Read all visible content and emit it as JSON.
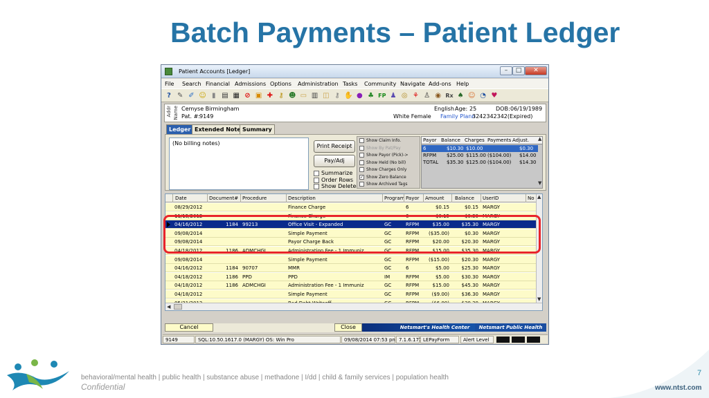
{
  "slide": {
    "title": "Batch Payments – Patient Ledger",
    "tagline": "behavioral/mental health | public health | substance abuse | methadone | I/dd | child & family services | population health",
    "confidential": "Confidential",
    "page_number": "7",
    "website": "www.ntst.com"
  },
  "window": {
    "title": "Patient Accounts [Ledger]",
    "min": "–",
    "max": "□",
    "close": "✕"
  },
  "menu": [
    "File",
    "Search",
    "Financial",
    "Admissions",
    "Options",
    "Administration",
    "Tasks",
    "Community",
    "Navigate",
    "Add-ons",
    "Help"
  ],
  "toolbar_icons": [
    {
      "name": "help-icon",
      "glyph": "?",
      "color": "#1e4fa0"
    },
    {
      "name": "wrench-icon",
      "glyph": "✎",
      "color": "#555"
    },
    {
      "name": "pencil-icon",
      "glyph": "✐",
      "color": "#2c6fc5"
    },
    {
      "name": "smiley-icon",
      "glyph": "☺",
      "color": "#c9a300"
    },
    {
      "name": "battery-icon",
      "glyph": "▮",
      "color": "#888"
    },
    {
      "name": "document-icon",
      "glyph": "▤",
      "color": "#333"
    },
    {
      "name": "calculator-icon",
      "glyph": "▦",
      "color": "#222"
    },
    {
      "name": "no-entry-icon",
      "glyph": "⊘",
      "color": "#d11"
    },
    {
      "name": "schedule-icon",
      "glyph": "▣",
      "color": "#d88a00"
    },
    {
      "name": "red-cross-icon",
      "glyph": "✚",
      "color": "#d11"
    },
    {
      "name": "key-icon",
      "glyph": "⚷",
      "color": "#b58a00"
    },
    {
      "name": "people-icon",
      "glyph": "☻",
      "color": "#2a7a2a"
    },
    {
      "name": "folder-icon",
      "glyph": "▭",
      "color": "#caa24a"
    },
    {
      "name": "printer-icon",
      "glyph": "▥",
      "color": "#444"
    },
    {
      "name": "folder-open-icon",
      "glyph": "◫",
      "color": "#caa24a"
    },
    {
      "name": "keys-icon",
      "glyph": "⚷",
      "color": "#777"
    },
    {
      "name": "hand-icon",
      "glyph": "✋",
      "color": "#b07b50"
    },
    {
      "name": "capsule-icon",
      "glyph": "●",
      "color": "#8a1fb8"
    },
    {
      "name": "leaf-icon",
      "glyph": "♣",
      "color": "#2a8a2a"
    },
    {
      "name": "fp-icon",
      "glyph": "FP",
      "color": "#1a8a1a"
    },
    {
      "name": "family-icon",
      "glyph": "♟",
      "color": "#5a4ab0"
    },
    {
      "name": "coins-icon",
      "glyph": "◎",
      "color": "#b08a20"
    },
    {
      "name": "ribbon-icon",
      "glyph": "⚘",
      "color": "#d11"
    },
    {
      "name": "child-icon",
      "glyph": "♙",
      "color": "#333"
    },
    {
      "name": "bear-icon",
      "glyph": "◉",
      "color": "#8a5a20"
    },
    {
      "name": "med-rec-icon",
      "glyph": "Rx",
      "color": "#444"
    },
    {
      "name": "tree-icon",
      "glyph": "♠",
      "color": "#2a6a2a"
    },
    {
      "name": "person-icon",
      "glyph": "☺",
      "color": "#d56a2a"
    },
    {
      "name": "clock-icon",
      "glyph": "◔",
      "color": "#1e4fa0"
    },
    {
      "name": "heart-icon",
      "glyph": "♥",
      "color": "#c2185b"
    }
  ],
  "patient": {
    "addr_tab": "Addr",
    "name_tab": "Name",
    "name": "Cemyse Birmingham",
    "pat_number_label": "Pat. #:",
    "pat_number": "9149",
    "race_sex": "White  Female",
    "language": "English",
    "age_label": "Age:",
    "age": "25",
    "dob_label": "DOB:",
    "dob": "06/19/1989",
    "plan_label": "Family Plann",
    "plan_value": "3242342342(Expired)"
  },
  "tabs": [
    "Ledger",
    "Extended Notes",
    "Summary"
  ],
  "notes_text": "(No billing notes)",
  "buttons": {
    "print_receipt": "Print Receipt",
    "pay_adj": "Pay/Adj",
    "cancel": "Cancel",
    "close": "Close"
  },
  "options": {
    "summarize": "Summarize",
    "order_rows": "Order Rows",
    "show_deleted": "Show Deleted"
  },
  "show_options": [
    {
      "label": "Show Claim Info.",
      "checked": false,
      "grey": false
    },
    {
      "label": "Show By Pat/Pay",
      "checked": false,
      "grey": true
    },
    {
      "label": "Show Payor (Pick)->",
      "checked": false,
      "grey": false
    },
    {
      "label": "Show Held (No bill)",
      "checked": false,
      "grey": false
    },
    {
      "label": "Show Charges Only",
      "checked": false,
      "grey": false
    },
    {
      "label": "Show Zero Balance",
      "checked": true,
      "grey": false
    },
    {
      "label": "Show Archived Tags",
      "checked": false,
      "grey": false
    }
  ],
  "summary": {
    "headers": [
      "Payor",
      "Balance",
      "Charges",
      "Payments",
      "Adjust."
    ],
    "rows": [
      {
        "payor": "6",
        "balance": "$10.30",
        "charges": "$10.00",
        "payments": "",
        "adjust": "$0.30",
        "selected": true
      },
      {
        "payor": "RFPM",
        "balance": "$25.00",
        "charges": "$115.00",
        "payments": "($104.00)",
        "adjust": "$14.00",
        "selected": false
      },
      {
        "payor": "TOTAL",
        "balance": "$35.30",
        "charges": "$125.00",
        "payments": "($104.00)",
        "adjust": "$14.30",
        "selected": false
      }
    ]
  },
  "ledger": {
    "headers": [
      "Date",
      "Document#",
      "Procedure",
      "Description",
      "Program",
      "Payor",
      "Amount",
      "Balance",
      "UserID",
      "No"
    ],
    "rows": [
      {
        "date": "08/29/2012",
        "doc": "",
        "proc": "",
        "desc": "Finance Charge",
        "prog": "",
        "payor": "6",
        "amount": "$0.15",
        "balance": "$0.15",
        "user": "MARGY",
        "selected": false
      },
      {
        "date": "11/15/2012",
        "doc": "",
        "proc": "",
        "desc": "Finance Charge",
        "prog": "",
        "payor": "6",
        "amount": "$0.15",
        "balance": "$0.30",
        "user": "MARGY",
        "selected": false
      },
      {
        "date": "04/16/2012",
        "doc": "1184",
        "proc": "99213",
        "desc": "Office Visit - Expanded",
        "prog": "GC",
        "payor": "RFPM",
        "amount": "$35.00",
        "balance": "$35.30",
        "user": "MARGY",
        "selected": true
      },
      {
        "date": "09/08/2014",
        "doc": "",
        "proc": "",
        "desc": "Simple Payment",
        "prog": "GC",
        "payor": "RFPM",
        "amount": "($35.00)",
        "balance": "$0.30",
        "user": "MARGY",
        "selected": false
      },
      {
        "date": "09/08/2014",
        "doc": "",
        "proc": "",
        "desc": "Payor Charge Back",
        "prog": "GC",
        "payor": "RFPM",
        "amount": "$20.00",
        "balance": "$20.30",
        "user": "MARGY",
        "selected": false
      },
      {
        "date": "04/18/2012",
        "doc": "1186",
        "proc": "ADMCHGI",
        "desc": "Administration Fee - 1 Immuniz",
        "prog": "GC",
        "payor": "RFPM",
        "amount": "$15.00",
        "balance": "$35.30",
        "user": "MARGY",
        "selected": false
      },
      {
        "date": "09/08/2014",
        "doc": "",
        "proc": "",
        "desc": "Simple Payment",
        "prog": "GC",
        "payor": "RFPM",
        "amount": "($15.00)",
        "balance": "$20.30",
        "user": "MARGY",
        "selected": false
      },
      {
        "date": "04/16/2012",
        "doc": "1184",
        "proc": "90707",
        "desc": "MMR",
        "prog": "GC",
        "payor": "6",
        "amount": "$5.00",
        "balance": "$25.30",
        "user": "MARGY",
        "selected": false
      },
      {
        "date": "04/18/2012",
        "doc": "1186",
        "proc": "PPD",
        "desc": "PPD",
        "prog": "IM",
        "payor": "RFPM",
        "amount": "$5.00",
        "balance": "$30.30",
        "user": "MARGY",
        "selected": false
      },
      {
        "date": "04/18/2012",
        "doc": "1186",
        "proc": "ADMCHGI",
        "desc": "Administration Fee - 1 Immuniz",
        "prog": "GC",
        "payor": "RFPM",
        "amount": "$15.00",
        "balance": "$45.30",
        "user": "MARGY",
        "selected": false
      },
      {
        "date": "04/18/2012",
        "doc": "",
        "proc": "",
        "desc": "Simple Payment",
        "prog": "GC",
        "payor": "RFPM",
        "amount": "($9.00)",
        "balance": "$36.30",
        "user": "MARGY",
        "selected": false
      },
      {
        "date": "05/31/2012",
        "doc": "",
        "proc": "",
        "desc": "Bad Debt Writeoff",
        "prog": "GC",
        "payor": "RFPM",
        "amount": "($6.00)",
        "balance": "$30.30",
        "user": "MARGY",
        "selected": false
      }
    ]
  },
  "branding": {
    "left": "Netsmart's Health Center",
    "right": "Netsmart Public Health"
  },
  "status": {
    "pat": "9149",
    "sql": "SQL:10.50.1617.0 (MARGY) OS: Win Pro",
    "datetime": "09/08/2014 07:53 pn",
    "version": "7.1.6.177",
    "form": "LEPayForm",
    "alert": "Alert Level"
  },
  "colors": {
    "title": "#2674a6",
    "highlight": "#e8242b",
    "selected_row": "#0a2a8c",
    "grid_row": "#fdfbc9"
  }
}
